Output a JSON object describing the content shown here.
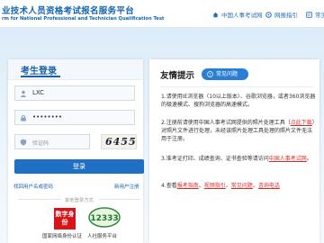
{
  "header": {
    "site_title": "业技术人员资格考试报名服务平台",
    "site_subtitle": "rm for National Professional and Technician Qualification Test",
    "nav": [
      {
        "label": "中国人事考试网",
        "icon": "home-icon"
      },
      {
        "label": "网报指引",
        "icon": "guide-icon"
      },
      {
        "label": "常见",
        "icon": "faq-icon"
      }
    ]
  },
  "login": {
    "title": "考生登录",
    "username_value": "LXC",
    "password_value": "••••••••",
    "captcha_placeholder": "验证码",
    "captcha_text": "64553",
    "login_button": "登录",
    "forgot_link": "找回用户名或密码",
    "register_link": "新用户注册",
    "other_methods_label": "其他登录方式",
    "badge1_text": "数字身份",
    "badge1_label": "国家网络身份认证",
    "badge2_text": "12333",
    "badge2_label": "人社服务平台"
  },
  "tips": {
    "title": "友情提示",
    "faq_button": "常见问题",
    "items": [
      "1.请使用IE浏览器（10以上版本）、谷歌浏览器，或者360浏览器的极速模式、搜狗浏览器的高速模式。",
      {
        "pre": "2.注册前请使用中国人事考试网提供的照片处理工具（",
        "link": "点此下载",
        "post": "）对照片文件进行处理，未经该照片处理工具处理的照片文件无法用于注册。"
      },
      {
        "pre": "3.准考证打印、成绩查询、证书查验等请访问",
        "link": "中国人事考试网",
        "post": "。"
      },
      {
        "pre": "4.查看",
        "links": [
          "报考指南",
          "视频指引",
          "常见问题",
          "咨询电话"
        ]
      }
    ]
  },
  "colors": {
    "brand": "#1565b0",
    "button": "#1f6fc2",
    "red_link": "#d92a2a"
  }
}
